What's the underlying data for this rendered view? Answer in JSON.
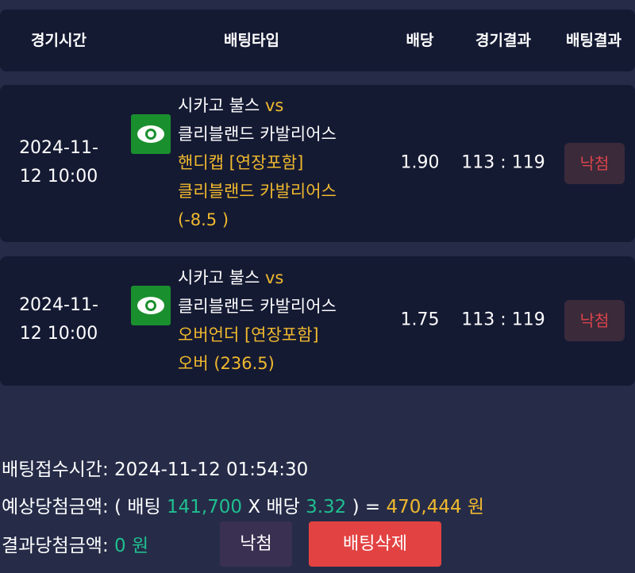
{
  "header": {
    "time": "경기시간",
    "type": "배팅타입",
    "odds": "배당",
    "game_result": "경기결과",
    "bet_result": "배팅결과"
  },
  "bets": [
    {
      "time": "2024-11-12 10:00",
      "home": "시카고 불스",
      "vs": "vs",
      "away": "클리블랜드 카발리어스",
      "market": "핸디캡 [연장포함]",
      "pick": "클리블랜드 카발리어스",
      "line": "(-8.5 )",
      "odds": "1.90",
      "score": "113 : 119",
      "result": "낙첨"
    },
    {
      "time": "2024-11-12 10:00",
      "home": "시카고 불스",
      "vs": "vs",
      "away": "클리블랜드 카발리어스",
      "market": "오버언더 [연장포함]",
      "pick": "오버 (236.5)",
      "odds": "1.75",
      "score": "113 : 119",
      "result": "낙첨"
    }
  ],
  "summary": {
    "receipt_label": "배팅접수시간:",
    "receipt_time": "2024-11-12 01:54:30",
    "expected_label": "예상당첨금액:",
    "open_paren": "( 배팅",
    "bet_amount": "141,700",
    "x_label": "X 배당",
    "total_odds": "3.32",
    "close_eq": ") =",
    "expected_amount": "470,444 원",
    "result_label": "결과당첨금액:",
    "result_amount": "0 원"
  },
  "buttons": {
    "status": "낙첨",
    "delete": "배팅삭제"
  },
  "colors": {
    "background": "#262c48",
    "card": "#151a33",
    "accent_yellow": "#f0b92e",
    "accent_green": "#1fbf8f",
    "lose_red": "#d9444a",
    "delete_button": "#e34242",
    "eye_button": "#1a8f2e"
  },
  "icons": {
    "detail": "eye-icon"
  }
}
